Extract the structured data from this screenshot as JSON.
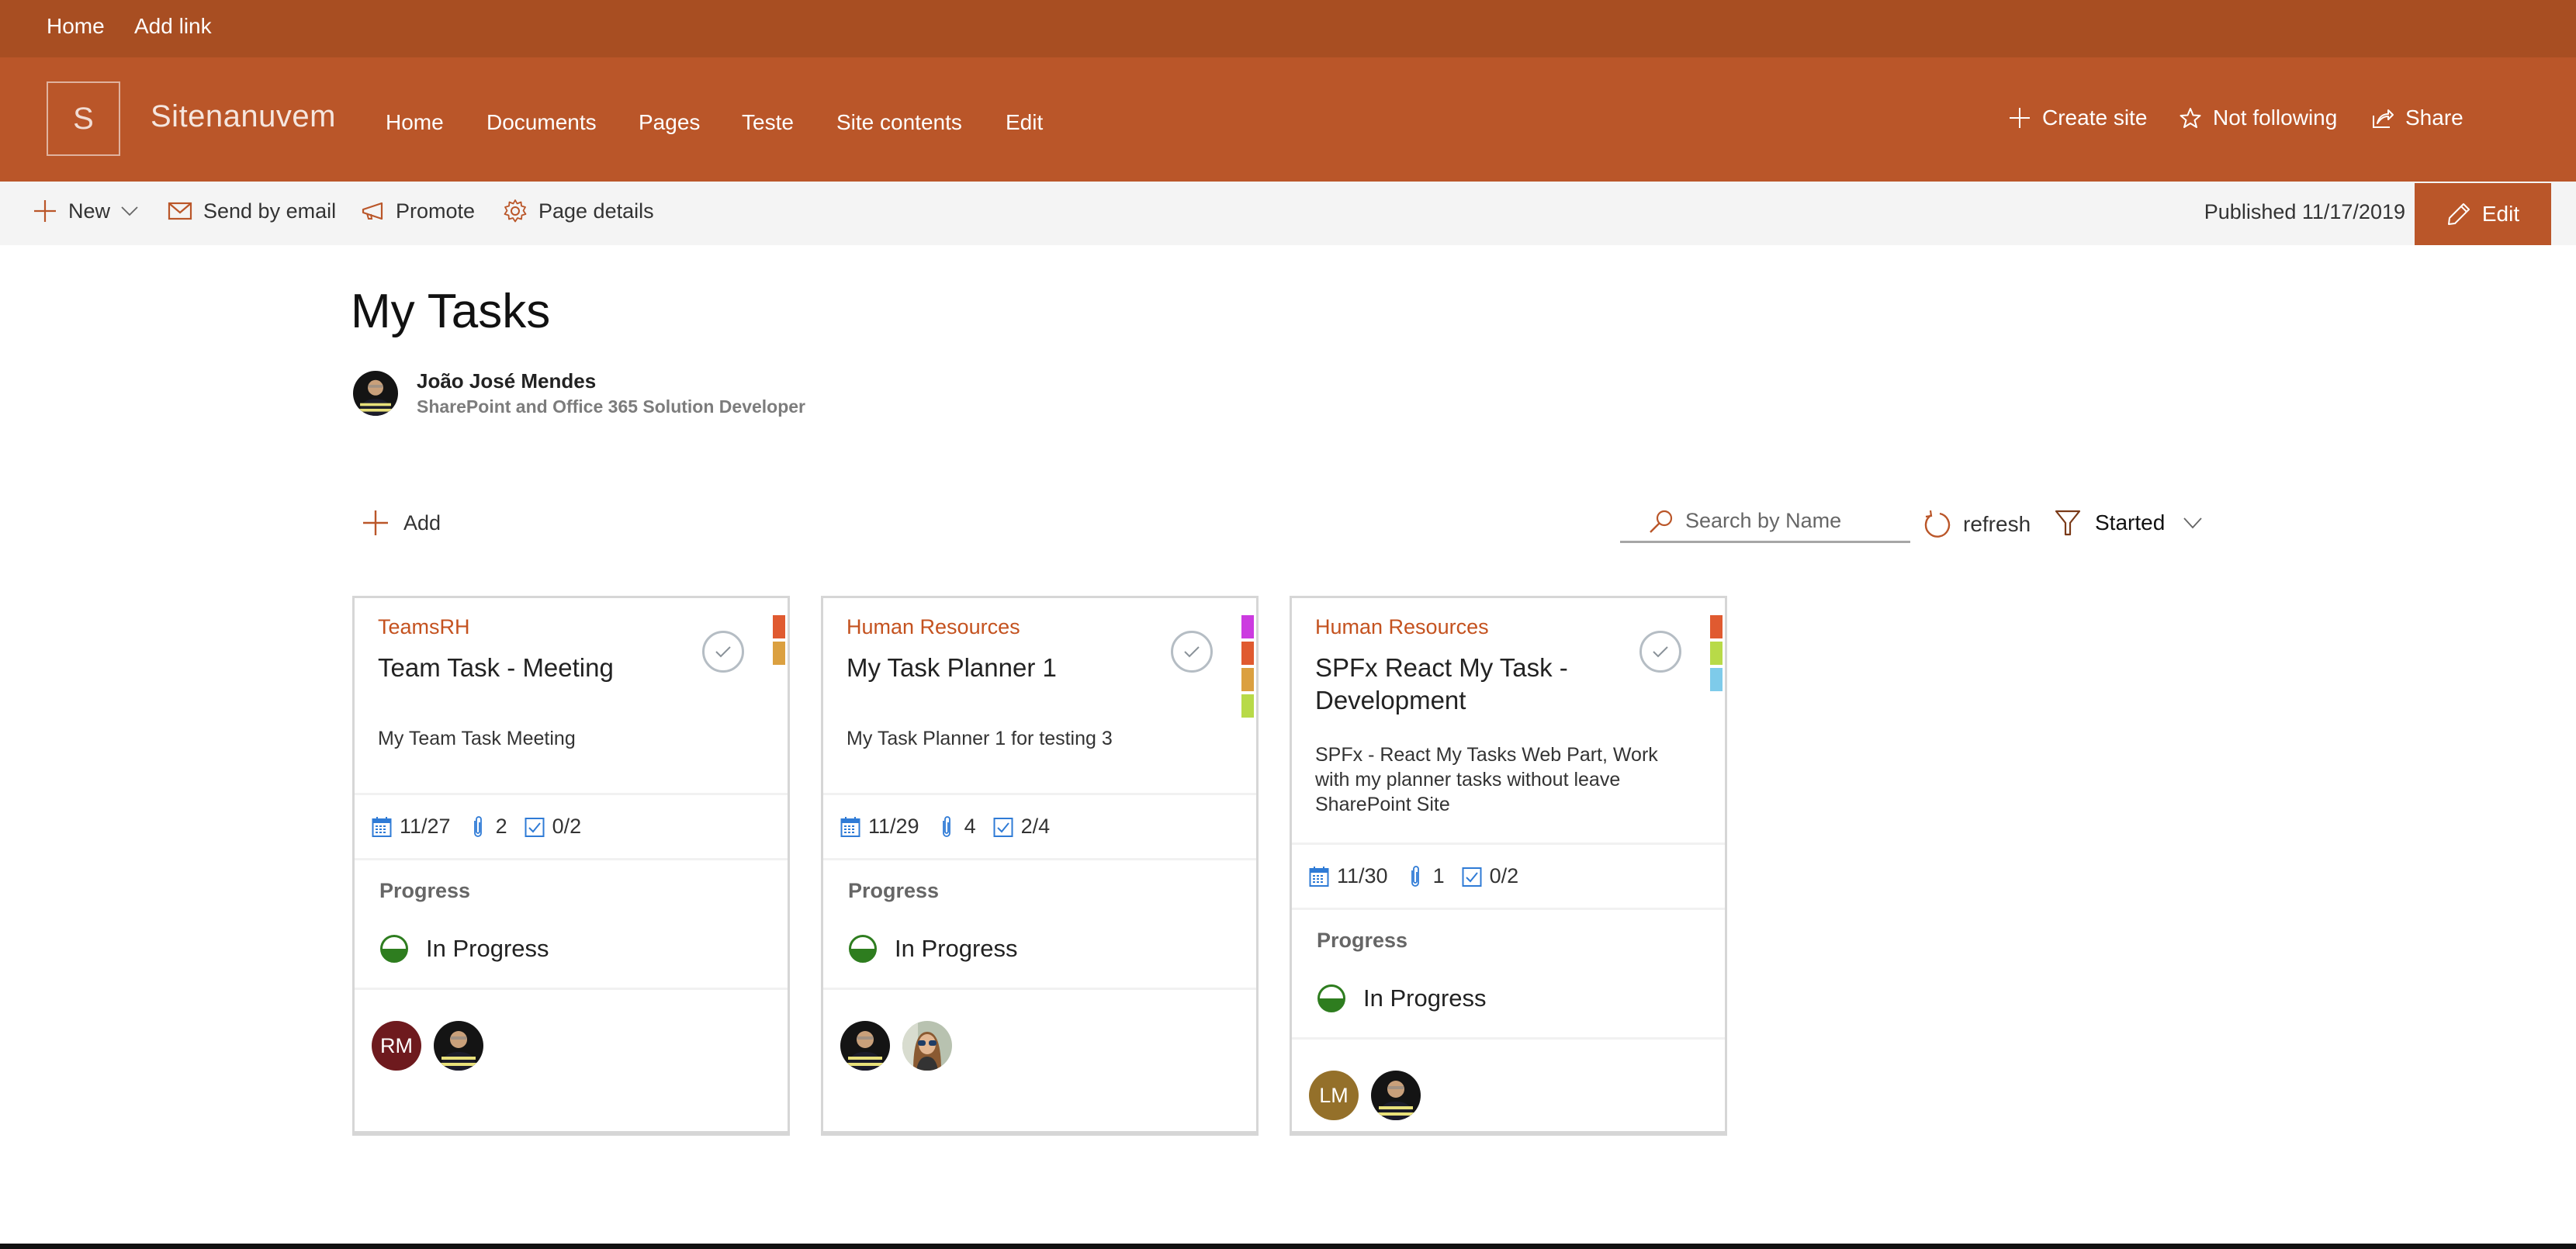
{
  "suite_bar": {
    "links": [
      {
        "label": "Home"
      },
      {
        "label": "Add link"
      }
    ]
  },
  "site_header": {
    "logo_letter": "S",
    "site_name": "Sitenanuvem",
    "nav": [
      {
        "label": "Home"
      },
      {
        "label": "Documents"
      },
      {
        "label": "Pages"
      },
      {
        "label": "Teste"
      },
      {
        "label": "Site contents"
      },
      {
        "label": "Edit"
      }
    ],
    "actions": {
      "create_site": "Create site",
      "follow": "Not following",
      "share": "Share"
    },
    "colors": {
      "suite_bar": "#A84E22",
      "header": "#BA5629"
    }
  },
  "command_bar": {
    "new": "New",
    "send_by_email": "Send by email",
    "promote": "Promote",
    "page_details": "Page details",
    "published": "Published 11/17/2019",
    "edit": "Edit"
  },
  "page": {
    "title": "My Tasks",
    "author": {
      "name": "João José Mendes",
      "role": "SharePoint and Office 365 Solution Developer"
    }
  },
  "toolbar": {
    "add": "Add",
    "search_placeholder": "Search by Name",
    "refresh": "refresh",
    "filter_selected": "Started"
  },
  "tasks": [
    {
      "bucket": "TeamsRH",
      "title": "Team Task - Meeting",
      "description": "My Team Task Meeting",
      "labels": [
        "#E05A30",
        "#DBA040"
      ],
      "due": "11/27",
      "attachments": "2",
      "checklist": "0/2",
      "progress_label": "Progress",
      "status": "In Progress",
      "assignees": [
        {
          "type": "initials",
          "initials": "RM",
          "color": "#6E1A1E"
        },
        {
          "type": "photo",
          "name": "João José Mendes"
        }
      ]
    },
    {
      "bucket": "Human Resources",
      "title": "My Task Planner 1",
      "description": "My Task Planner 1 for testing 3",
      "labels": [
        "#CC3BE0",
        "#E05A30",
        "#DBA040",
        "#B8DA48"
      ],
      "due": "11/29",
      "attachments": "4",
      "checklist": "2/4",
      "progress_label": "Progress",
      "status": "In Progress",
      "assignees": [
        {
          "type": "photo",
          "name": "João José Mendes"
        },
        {
          "type": "photo",
          "name": "Team member"
        }
      ]
    },
    {
      "bucket": "Human Resources",
      "title": "SPFx React My Task - Development",
      "description": "SPFx - React My Tasks Web Part, Work with my planner tasks without leave SharePoint Site",
      "labels": [
        "#E05A30",
        "#B8DA48",
        "#7ECBEA"
      ],
      "due": "11/30",
      "attachments": "1",
      "checklist": "0/2",
      "progress_label": "Progress",
      "status": "In Progress",
      "assignees": [
        {
          "type": "initials",
          "initials": "LM",
          "color": "#94702A"
        },
        {
          "type": "photo",
          "name": "João José Mendes"
        }
      ]
    }
  ]
}
